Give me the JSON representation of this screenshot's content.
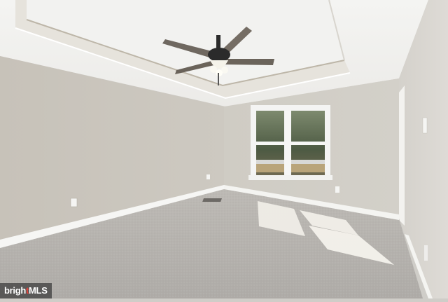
{
  "watermark": {
    "prefix": "brigh",
    "mark": "t",
    "suffix": "MLS"
  },
  "colors": {
    "ceiling": "#f3f3f1",
    "tray_ceiling": "#efeeec",
    "crown_trim": "#e8e6e0",
    "left_wall": "#c9c4bb",
    "back_wall": "#cfcbc3",
    "right_wall": "#d9d6d0",
    "baseboard": "#f6f6f4",
    "carpet": "#b9b6b2",
    "sunlight": "#f4f2ec",
    "window_frame": "#f7f7f7",
    "trees": "#4f5d46",
    "fan_blade": "#6f6860",
    "fan_motor": "#2b2b2b"
  }
}
